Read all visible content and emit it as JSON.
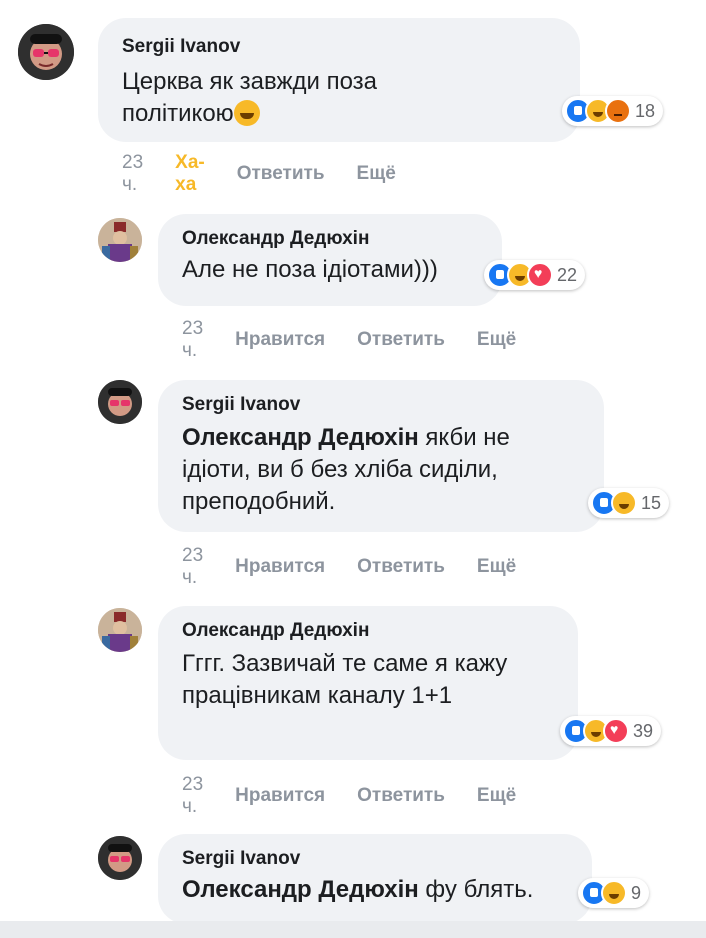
{
  "comments": [
    {
      "author": "Sergii Ivanov",
      "text": "Церква як завжди поза політикою",
      "reaction_count": "18",
      "reactions": [
        "like",
        "haha",
        "angry"
      ],
      "time": "23 ч.",
      "react_label": "Ха-ха",
      "reply_label": "Ответить",
      "more_label": "Ещё"
    },
    {
      "author": "Олександр Дедюхін",
      "text": "Але не поза ідіотами)))",
      "reaction_count": "22",
      "reactions": [
        "like",
        "haha",
        "love"
      ],
      "time": "23 ч.",
      "react_label": "Нравится",
      "reply_label": "Ответить",
      "more_label": "Ещё"
    },
    {
      "author": "Sergii Ivanov",
      "mention": "Олександр Дедюхін",
      "text": " якби не ідіоти, ви б без хліба сиділи, преподобний.",
      "reaction_count": "15",
      "reactions": [
        "like",
        "haha"
      ],
      "time": "23 ч.",
      "react_label": "Нравится",
      "reply_label": "Ответить",
      "more_label": "Ещё"
    },
    {
      "author": "Олександр Дедюхін",
      "text": "Гггг. Зазвичай те саме я кажу працівникам каналу 1+1",
      "reaction_count": "39",
      "reactions": [
        "like",
        "haha",
        "love"
      ],
      "time": "23 ч.",
      "react_label": "Нравится",
      "reply_label": "Ответить",
      "more_label": "Ещё"
    },
    {
      "author": "Sergii Ivanov",
      "mention": "Олександр Дедюхін",
      "text": " фу блять.",
      "reaction_count": "9",
      "reactions": [
        "like",
        "haha"
      ]
    }
  ],
  "colors": {
    "bubble": "#f0f2f5",
    "like": "#1877f2",
    "haha": "#f7b928",
    "angry": "#e9710f",
    "love": "#f33e58",
    "meta_text": "#8d949e"
  }
}
